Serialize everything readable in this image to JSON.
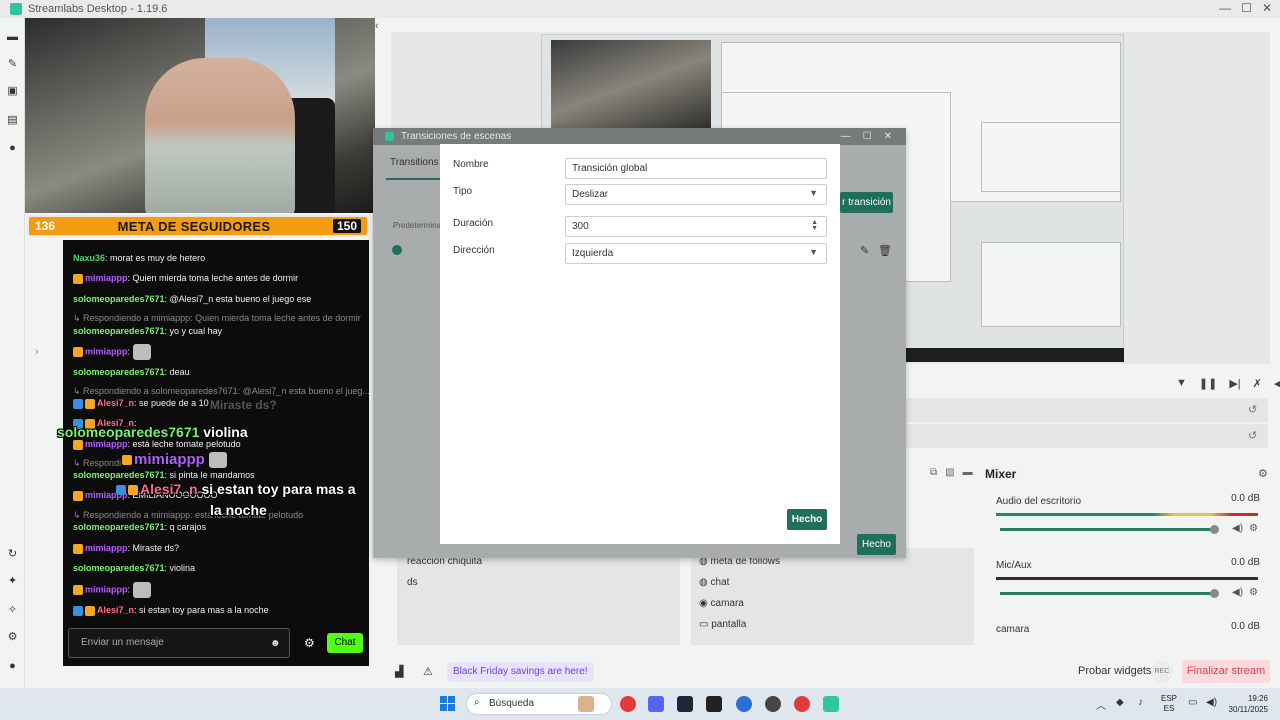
{
  "app": {
    "title": "Streamlabs Desktop - 1.19.6"
  },
  "window_controls": [
    "—",
    "☐",
    "✕"
  ],
  "goal": {
    "current": "136",
    "label": "META DE SEGUIDORES",
    "target": "150"
  },
  "chat": {
    "messages": [
      {
        "user": "Naxu36",
        "text": ": morat es muy de hetero"
      },
      {
        "user": "mimiappp",
        "text": ": Quien mierda toma leche antes de dormir"
      },
      {
        "user": "solomeoparedes7671",
        "text": ": @Alesi7_n esta bueno el juego ese"
      },
      {
        "reply": "↳ Respondiendo a mimiappp: Quien mierda toma leche antes de dormir"
      },
      {
        "user": "solomeoparedes7671",
        "text": ": yo y cual hay"
      },
      {
        "user": "mimiappp",
        "text": ":"
      },
      {
        "user": "solomeoparedes7671",
        "text": ": deau"
      },
      {
        "reply": "↳ Respondiendo a solomeoparedes7671: @Alesi7_n esta bueno el jueg..."
      },
      {
        "user": "Alesi7_n",
        "text": ": se puede de a 10"
      },
      {
        "user": "Alesi7_n",
        "text": ":"
      },
      {
        "user": "mimiappp",
        "text": ": está leche tomate pelotudo"
      },
      {
        "reply": "↳ Respondi"
      },
      {
        "user": "solomeoparedes7671",
        "text": ": si pinta le mandamos"
      },
      {
        "user": "mimiappp",
        "text": ": EMILIANOOOOOOO"
      },
      {
        "reply": "↳ Respondiendo a mimiappp: está leche tomate pelotudo"
      },
      {
        "user": "solomeoparedes7671",
        "text": ": q carajos"
      },
      {
        "user": "mimiappp",
        "text": ": Miraste ds?"
      },
      {
        "user": "solomeoparedes7671",
        "text": ": violina"
      },
      {
        "user": "mimiappp",
        "text": ":"
      },
      {
        "user": "Alesi7_n",
        "text": ": si estan toy para mas a la noche"
      }
    ],
    "overlay": {
      "ghost": "Miraste ds?",
      "line1_user": "solomeoparedes7671",
      "line1_text": "violina",
      "line2_user": "mimiappp",
      "line3_user": "Alesi7_n",
      "line3_text": "si estan toy para mas a",
      "line3_text2": "la noche"
    },
    "input_placeholder": "Enviar un mensaje",
    "send_label": "Chat"
  },
  "transitions_window": {
    "title": "Transiciones de escenas",
    "tab": "Transitions",
    "default_label": "Predetermina",
    "add_button": "r transición",
    "done_button": "Hecho"
  },
  "dialog": {
    "fields": [
      {
        "label": "Nombre",
        "value": "Transición global"
      },
      {
        "label": "Tipo",
        "value": "Deslizar"
      },
      {
        "label": "Duración",
        "value": "300"
      },
      {
        "label": "Dirección",
        "value": "Izquierda"
      }
    ],
    "done_button": "Hecho"
  },
  "sources": {
    "left": [
      "reacción chiquita",
      "ds"
    ],
    "right": [
      "meta de follows",
      "chat",
      "camara",
      "pantalla"
    ]
  },
  "mixer": {
    "title": "Mixer",
    "channels": [
      {
        "name": "Audio del escritorio",
        "db": "0.0 dB"
      },
      {
        "name": "Mic/Aux",
        "db": "0.0 dB"
      },
      {
        "name": "camara",
        "db": "0.0 dB"
      }
    ]
  },
  "footer": {
    "promo": "Black Friday savings are here!",
    "test_widgets": "Probar widgets",
    "rec": "REC",
    "end_stream": "Finalizar stream"
  },
  "taskbar": {
    "search": "Búsqueda",
    "lang_top": "ESP",
    "lang_bottom": "ES",
    "time": "19:26",
    "date": "30/11/2025"
  }
}
